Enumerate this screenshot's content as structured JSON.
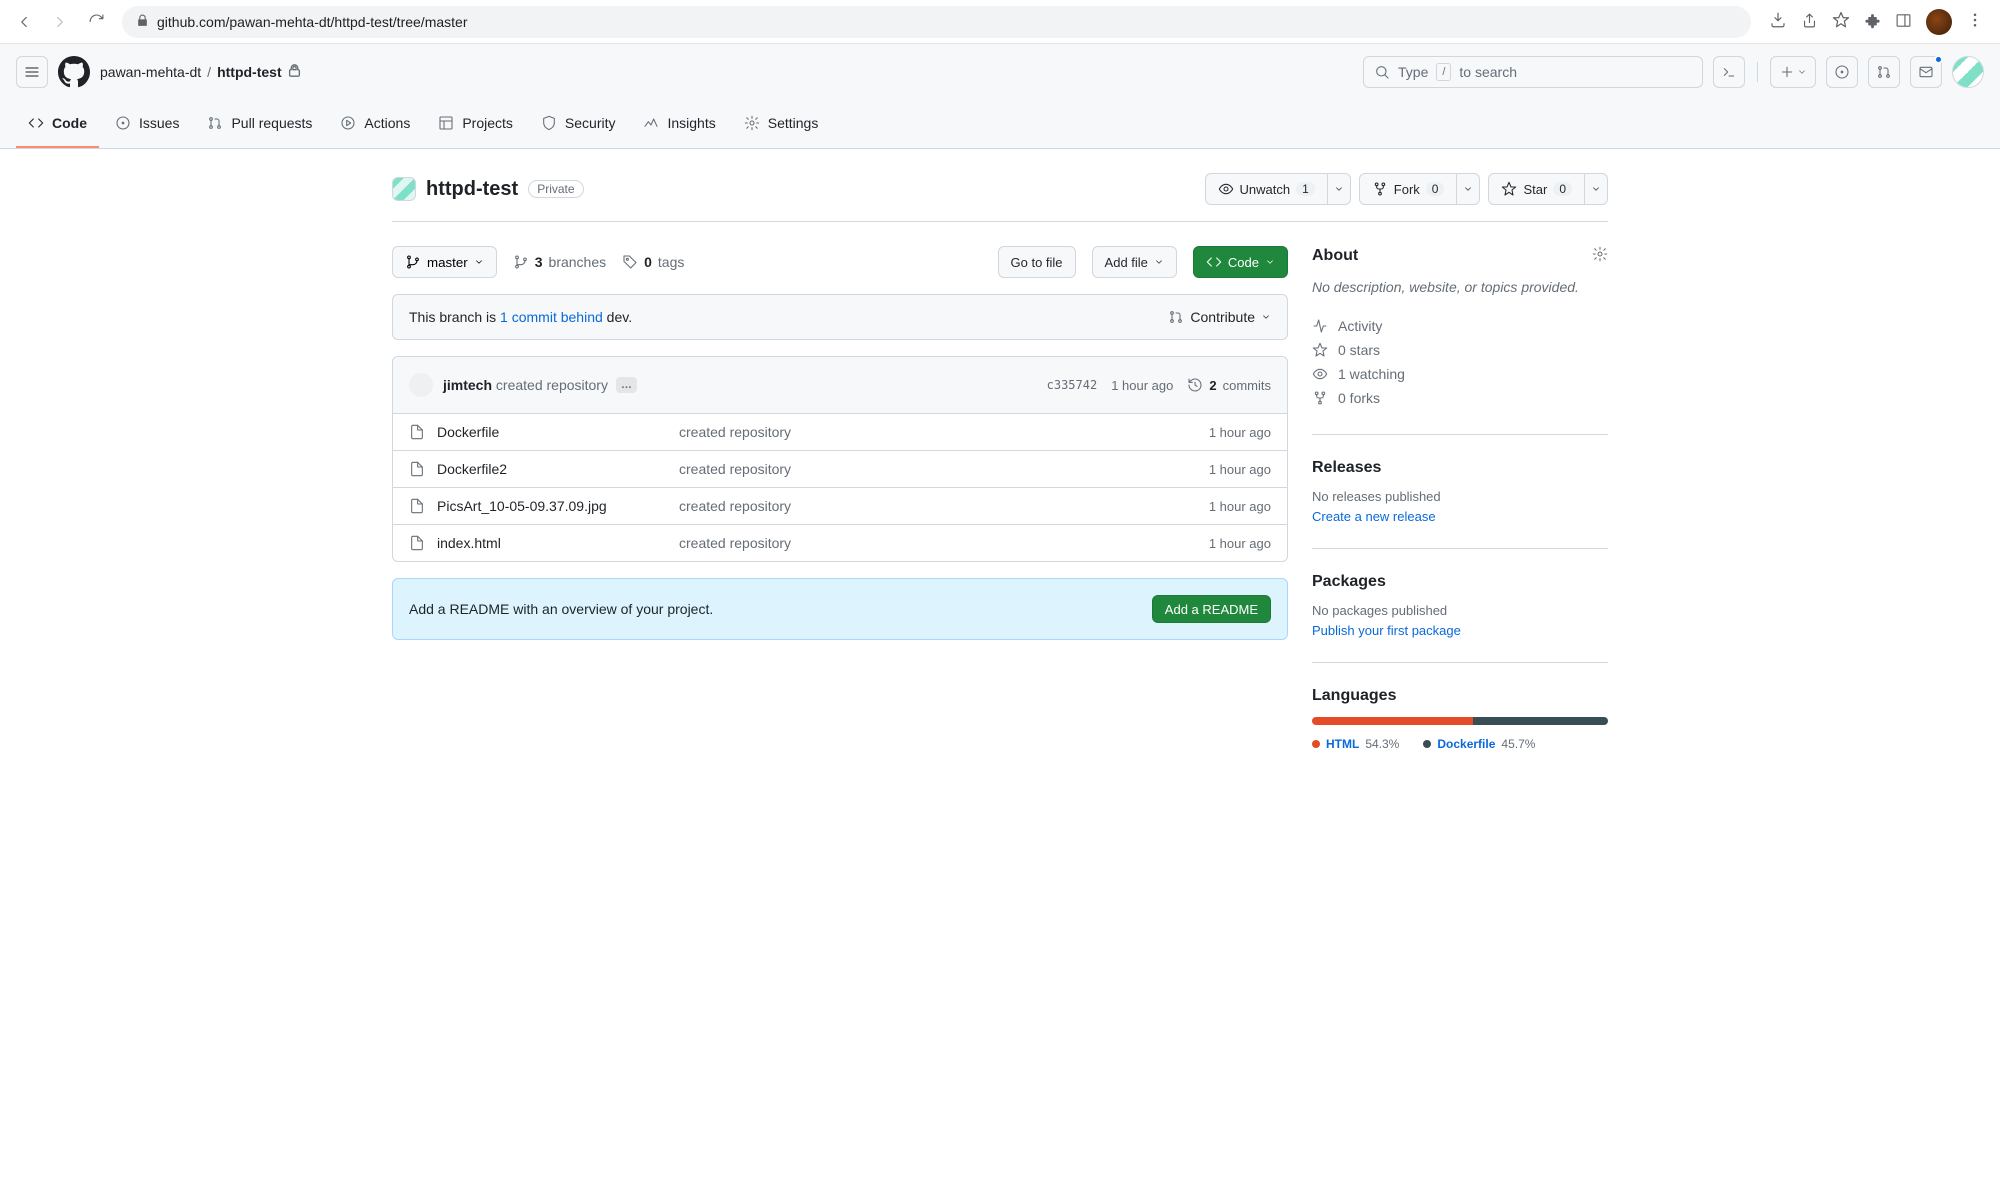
{
  "browser": {
    "url": "github.com/pawan-mehta-dt/httpd-test/tree/master"
  },
  "breadcrumb": {
    "owner": "pawan-mehta-dt",
    "repo": "httpd-test"
  },
  "search": {
    "prefix": "Type",
    "slash": "/",
    "suffix": "to search"
  },
  "tabs": {
    "code": "Code",
    "issues": "Issues",
    "pulls": "Pull requests",
    "actions": "Actions",
    "projects": "Projects",
    "security": "Security",
    "insights": "Insights",
    "settings": "Settings"
  },
  "repo": {
    "name": "httpd-test",
    "visibility": "Private"
  },
  "head_actions": {
    "unwatch": "Unwatch",
    "unwatch_count": "1",
    "fork": "Fork",
    "fork_count": "0",
    "star": "Star",
    "star_count": "0"
  },
  "filenav": {
    "branch": "master",
    "branches_count": "3",
    "branches_label": "branches",
    "tags_count": "0",
    "tags_label": "tags",
    "goto": "Go to file",
    "addfile": "Add file",
    "code": "Code"
  },
  "banner": {
    "prefix": "This branch is ",
    "link": "1 commit behind",
    "suffix": " dev.",
    "contribute": "Contribute"
  },
  "commit_header": {
    "author": "jimtech",
    "message": "created repository",
    "more": "…",
    "sha": "c335742",
    "time": "1 hour ago",
    "commits_count": "2",
    "commits_label": "commits"
  },
  "files": [
    {
      "name": "Dockerfile",
      "msg": "created repository",
      "time": "1 hour ago"
    },
    {
      "name": "Dockerfile2",
      "msg": "created repository",
      "time": "1 hour ago"
    },
    {
      "name": "PicsArt_10-05-09.37.09.jpg",
      "msg": "created repository",
      "time": "1 hour ago"
    },
    {
      "name": "index.html",
      "msg": "created repository",
      "time": "1 hour ago"
    }
  ],
  "readme_prompt": {
    "text": "Add a README with an overview of your project.",
    "button": "Add a README"
  },
  "sidebar": {
    "about": {
      "title": "About",
      "desc": "No description, website, or topics provided.",
      "activity": "Activity",
      "stars": "0 stars",
      "watching": "1 watching",
      "forks": "0 forks"
    },
    "releases": {
      "title": "Releases",
      "none": "No releases published",
      "link": "Create a new release"
    },
    "packages": {
      "title": "Packages",
      "none": "No packages published",
      "link": "Publish your first package"
    },
    "languages": {
      "title": "Languages",
      "items": [
        {
          "name": "HTML",
          "pct": "54.3%",
          "color": "#e34c26"
        },
        {
          "name": "Dockerfile",
          "pct": "45.7%",
          "color": "#384d54"
        }
      ]
    }
  }
}
